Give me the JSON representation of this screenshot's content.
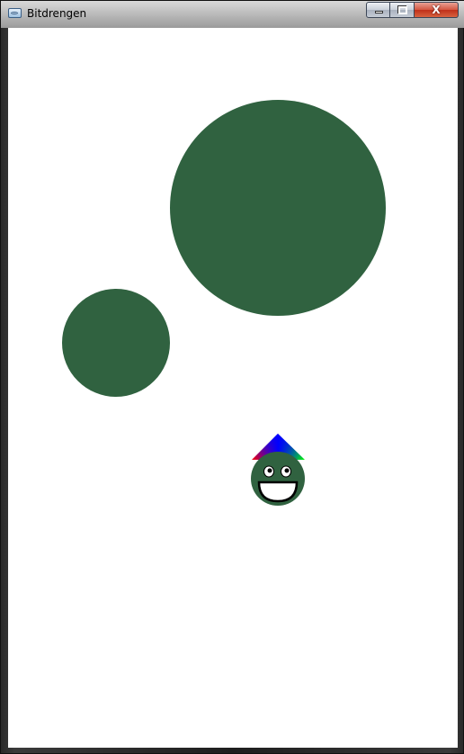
{
  "window": {
    "title": "Bitdrengen",
    "app_icon": "java-cup-icon",
    "buttons": {
      "minimize_icon": "minimize-icon",
      "maximize_icon": "maximize-icon",
      "close_glyph": "X"
    }
  },
  "scene": {
    "background_color": "#ffffff",
    "obstacle_color": "#306240",
    "player": {
      "body_color": "#306240",
      "mouth_color": "#ffffff",
      "hat_gradient": [
        "#ff0000",
        "#0000ff",
        "#00ff00"
      ]
    }
  }
}
